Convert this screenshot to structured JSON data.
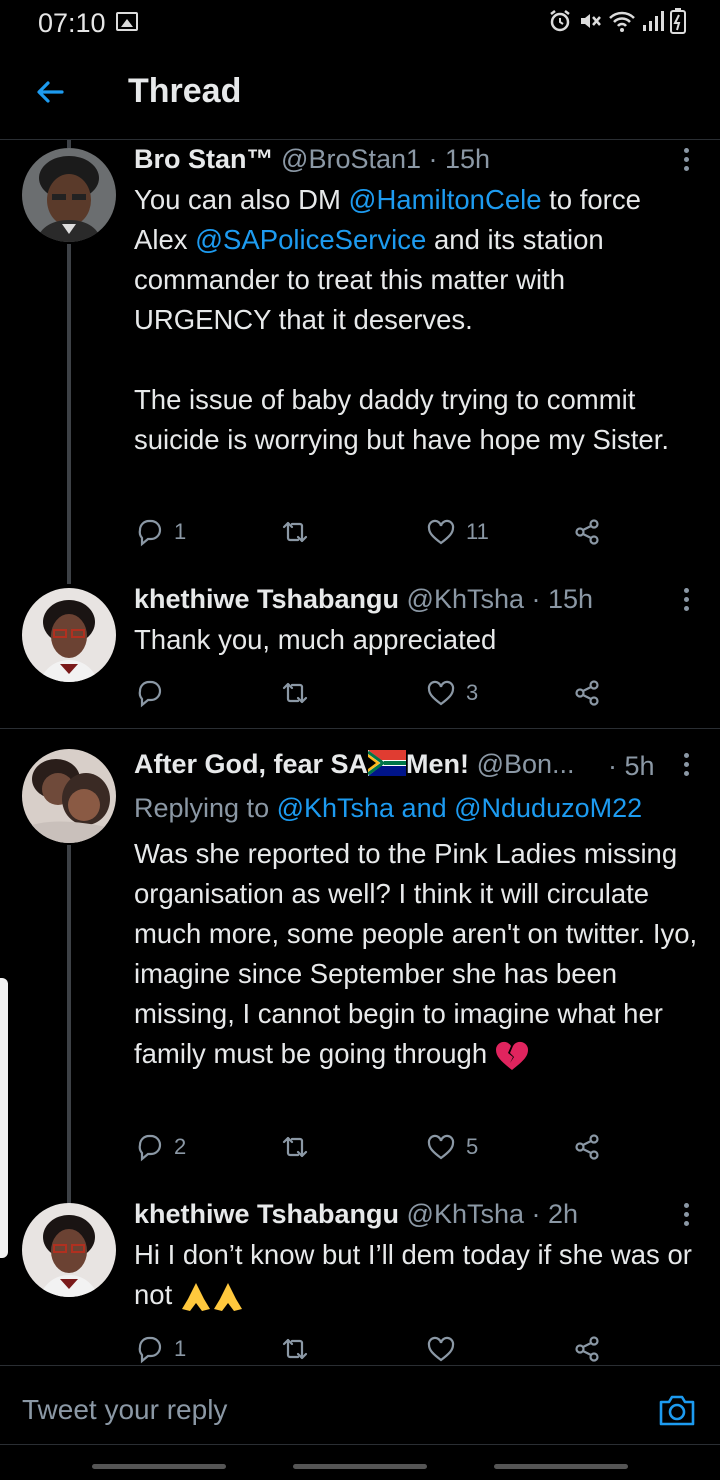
{
  "status_bar": {
    "time": "07:10",
    "icons": [
      "image-icon",
      "alarm-icon",
      "mute-icon",
      "wifi-icon",
      "signal-icon",
      "battery-icon"
    ]
  },
  "header": {
    "back_icon": "arrow-left-icon",
    "title": "Thread"
  },
  "colors": {
    "background": "#000000",
    "accent": "#1d9bf0",
    "muted": "#8b98a5",
    "text": "#e7e9ea",
    "heartbreak": "#e0245e"
  },
  "tweets": [
    {
      "name": "Bro Stan™",
      "handle": "@BroStan1",
      "time": "· 15h",
      "body_pre": "You can also DM ",
      "mention1": "@HamiltonCele",
      "body_mid1": " to force\nAlex ",
      "mention2": "@SAPoliceService",
      "body_post": " and its  station commander to treat this matter with URGENCY that it deserves.\n\nThe issue of baby daddy trying to commit suicide is worrying but have hope my Sister.",
      "replies": "1",
      "retweets": "",
      "likes": "11"
    },
    {
      "name": "khethiwe Tshabangu",
      "handle": "@KhTsha",
      "time": "· 15h",
      "body": "Thank you, much appreciated",
      "replies": "",
      "retweets": "",
      "likes": "3"
    },
    {
      "name": "After God, fear SA",
      "name_suffix": "Men!",
      "flag_icon": "south-africa-flag-icon",
      "handle": "@Bon...",
      "time": "· 5h",
      "replying_label": "Replying to ",
      "replying_to": "@KhTsha and @NduduzoM22",
      "body": "Was she reported to the Pink Ladies missing organisation as well? I think it will circulate much more, some people aren't on twitter. Iyo, imagine since September she has been missing, I cannot begin to imagine what her family must be going through",
      "emoji": "broken-heart-icon",
      "replies": "2",
      "retweets": "",
      "likes": "5"
    },
    {
      "name": "khethiwe Tshabangu",
      "handle": "@KhTsha",
      "time": "· 2h",
      "body": "Hi I don’t know but I’ll dem today if she was or not",
      "emoji": "folded-hands-icon",
      "replies": "1",
      "retweets": "",
      "likes": ""
    }
  ],
  "reply_bar": {
    "placeholder": "Tweet your reply",
    "camera_icon": "camera-icon"
  }
}
